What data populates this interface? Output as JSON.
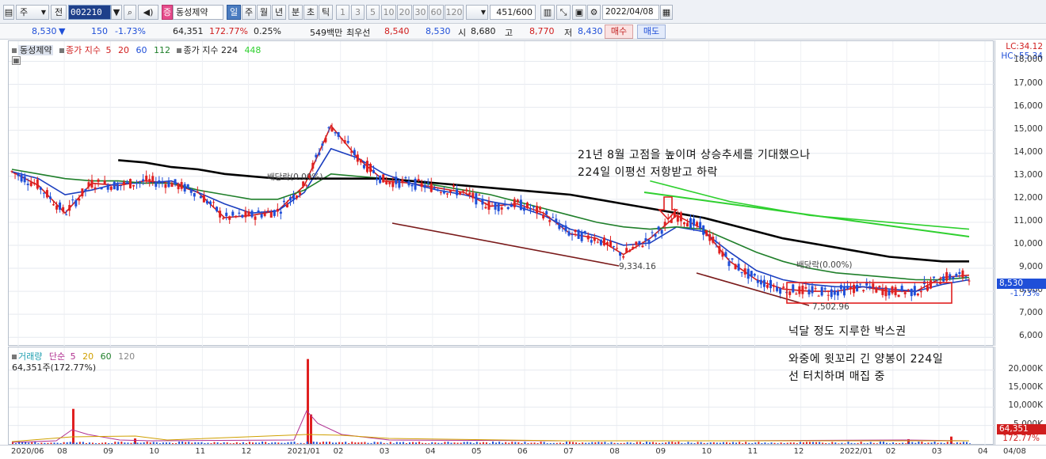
{
  "toolbar": {
    "period_select": "주",
    "prev_label": "전",
    "stock_code": "002210",
    "stock_name": "동성제약",
    "period_buttons": [
      "일",
      "주",
      "월",
      "년",
      "분",
      "초",
      "틱"
    ],
    "selected_period": "일",
    "interval_buttons": [
      "1",
      "3",
      "5",
      "10",
      "20",
      "30",
      "60",
      "120"
    ],
    "bar_count": "451/600",
    "date": "2022/04/08"
  },
  "quote": {
    "price": "8,530",
    "change_arrow": "▼",
    "change": "150",
    "change_pct": "-1.73%",
    "volume": "64,351",
    "volume_ratio": "172.77%",
    "turnover": "0.25%",
    "amount": "549백만",
    "best_bid_label": "최우선",
    "best_ask": "8,540",
    "best_bid": "8,530",
    "open_label": "시",
    "open": "8,680",
    "high_label": "고",
    "high": "8,770",
    "low_label": "저",
    "low": "8,430",
    "buy_button": "매수",
    "sell_button": "매도"
  },
  "price_panel": {
    "legend_name": "동성제약",
    "legend_ma_label": "종가 지수",
    "legend_ma_periods": [
      "5",
      "20",
      "60",
      "112"
    ],
    "legend_ma2_label": "종가 지수 224",
    "legend_ma2_period": "448",
    "lc_label": "LC:34.12",
    "hc_label": "HC:-55.34",
    "current_price_tag": "8,530",
    "current_change_tag": "-1.73%",
    "annotation_1_line1": "21년 8월 고점을 높이며 상승추세를 기대했으나",
    "annotation_1_line2": "224일 이평선 저항받고 하락",
    "annotation_2": "넉달 정도 지루한 박스권",
    "dividend_label_1": "배당락(0.00%)",
    "dividend_label_2": "배당락(0.00%)",
    "low_label_1": "9,334.16",
    "low_label_2": "7,502.96"
  },
  "volume_panel": {
    "legend_name": "거래량",
    "legend_ma_label": "단순",
    "legend_ma_periods": [
      "5",
      "20",
      "60",
      "120"
    ],
    "volume_text": "64,351주(172.77%)",
    "annotation_line1": "와중에 윗꼬리 긴 양봉이 224일",
    "annotation_line2": "선 터치하며 매집 중",
    "current_volume_tag": "64,351",
    "current_ratio_tag": "172.77%"
  },
  "chart_data": {
    "type": "line",
    "title": "",
    "price_axis_ticks": [
      "18,000",
      "17,000",
      "16,000",
      "15,000",
      "14,000",
      "13,000",
      "12,000",
      "11,000",
      "10,000",
      "9,000",
      "8,000",
      "7,000",
      "6,000"
    ],
    "volume_axis_ticks": [
      "20,000K",
      "15,000K",
      "10,000K",
      "5,000K"
    ],
    "date_ticks": [
      "2020/06",
      "08",
      "09",
      "10",
      "11",
      "12",
      "2021/01",
      "02",
      "03",
      "04",
      "05",
      "06",
      "07",
      "08",
      "09",
      "10",
      "11",
      "12",
      "2022/01",
      "02",
      "03",
      "04",
      "04/08"
    ],
    "ylim": [
      5800,
      18600
    ],
    "series": [
      {
        "name": "5",
        "color": "#d01d1d",
        "values": [
          13200,
          12600,
          11400,
          12700,
          12600,
          12800,
          12700,
          12300,
          11200,
          11300,
          11500,
          12600,
          15200,
          13800,
          12800,
          12700,
          12500,
          12300,
          11700,
          11800,
          11400,
          10500,
          10300,
          9600,
          10300,
          11300,
          10700,
          9300,
          8500,
          8100,
          8000,
          8000,
          8200,
          8000,
          8000,
          8600,
          8700
        ]
      },
      {
        "name": "20",
        "color": "#1c3fbf",
        "values": [
          13200,
          12900,
          12200,
          12400,
          12700,
          12700,
          12800,
          12300,
          11800,
          11400,
          11500,
          12300,
          14200,
          13800,
          13100,
          12700,
          12400,
          12200,
          11900,
          11700,
          11300,
          10700,
          10400,
          10000,
          10100,
          10800,
          10600,
          9700,
          8900,
          8500,
          8300,
          8200,
          8200,
          8100,
          8000,
          8300,
          8500
        ]
      },
      {
        "name": "60",
        "color": "#1f7f2a",
        "values": [
          13300,
          13100,
          12900,
          12800,
          12800,
          12700,
          12700,
          12400,
          12200,
          12000,
          12000,
          12400,
          13100,
          13000,
          12900,
          12800,
          12600,
          12400,
          12200,
          11900,
          11600,
          11300,
          11000,
          10800,
          10700,
          10800,
          10700,
          10200,
          9700,
          9300,
          9000,
          8800,
          8700,
          8600,
          8500,
          8500,
          8600
        ]
      },
      {
        "name": "224",
        "color": "#000000",
        "values": [
          null,
          null,
          null,
          null,
          13700,
          13600,
          13400,
          13300,
          13100,
          13000,
          12900,
          12900,
          12900,
          12900,
          12900,
          12800,
          12700,
          12600,
          12500,
          12400,
          12300,
          12200,
          12000,
          11800,
          11600,
          11400,
          11200,
          10900,
          10600,
          10300,
          10100,
          9900,
          9700,
          9500,
          9400,
          9300,
          9300
        ]
      },
      {
        "name": "448",
        "color": "#2fd02f",
        "values": [
          null,
          null,
          null,
          null,
          null,
          null,
          null,
          null,
          null,
          null,
          null,
          null,
          null,
          null,
          null,
          null,
          null,
          null,
          null,
          null,
          null,
          null,
          null,
          null,
          12800,
          12500,
          12200,
          11900,
          11700,
          11500,
          11300,
          11200,
          11100,
          11000,
          10900,
          10800,
          10700
        ]
      }
    ],
    "volume_spikes": [
      {
        "date": "2020/07",
        "value": 9500
      },
      {
        "date": "2020/09",
        "value": 1500
      },
      {
        "date": "2021/01",
        "value": 23000
      },
      {
        "date": "2021/01",
        "value": 8000
      },
      {
        "date": "2022/03",
        "value": 1300
      },
      {
        "date": "2022/04",
        "value": 2000
      }
    ]
  }
}
